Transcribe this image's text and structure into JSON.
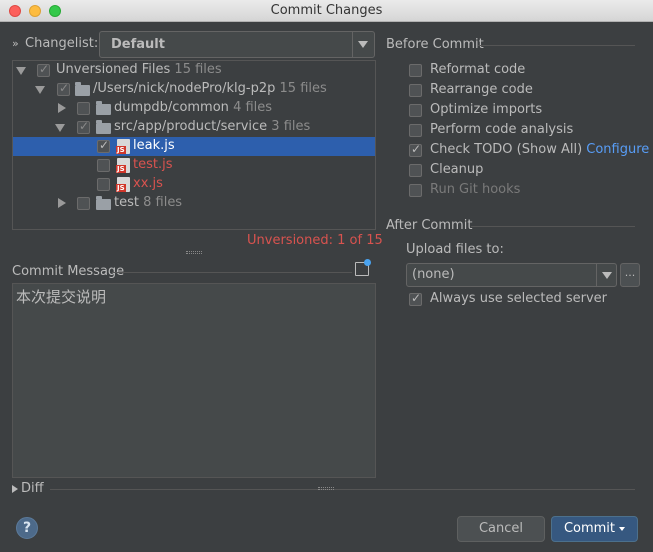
{
  "window": {
    "title": "Commit Changes"
  },
  "changelist": {
    "label": "Changelist:",
    "value": "Default"
  },
  "tree": {
    "rows": [
      {
        "name": "Unversioned Files",
        "count": "15 files"
      },
      {
        "name": "/Users/nick/nodePro/klg-p2p",
        "count": "15 files"
      },
      {
        "name": "dumpdb/common",
        "count": "4 files"
      },
      {
        "name": "src/app/product/service",
        "count": "3 files"
      },
      {
        "name": "leak.js",
        "count": ""
      },
      {
        "name": "test.js",
        "count": ""
      },
      {
        "name": "xx.js",
        "count": ""
      },
      {
        "name": "test",
        "count": "8 files"
      }
    ],
    "js_badge": "JS",
    "status": "Unversioned: 1 of 15"
  },
  "commit_message": {
    "label": "Commit Message",
    "text": "本次提交说明"
  },
  "diff": {
    "label": "Diff"
  },
  "before_commit": {
    "title": "Before Commit",
    "options": [
      {
        "label": "Reformat code",
        "checked": false
      },
      {
        "label": "Rearrange code",
        "checked": false
      },
      {
        "label": "Optimize imports",
        "checked": false
      },
      {
        "label": "Perform code analysis",
        "checked": false
      },
      {
        "label": "Check TODO (Show All)",
        "checked": true,
        "link": "Configure"
      },
      {
        "label": "Cleanup",
        "checked": false
      },
      {
        "label": "Run Git hooks",
        "checked": false,
        "disabled": true
      }
    ]
  },
  "after_commit": {
    "title": "After Commit",
    "upload_label": "Upload files to:",
    "upload_value": "(none)",
    "more_label": "...",
    "always_label": "Always use selected server"
  },
  "buttons": {
    "help": "?",
    "cancel": "Cancel",
    "commit": "Commit"
  },
  "colors": {
    "background": "#3c3f41",
    "selection": "#2d5fad",
    "unversioned": "#d9534f",
    "link": "#589df6",
    "primary_button": "#365880"
  }
}
